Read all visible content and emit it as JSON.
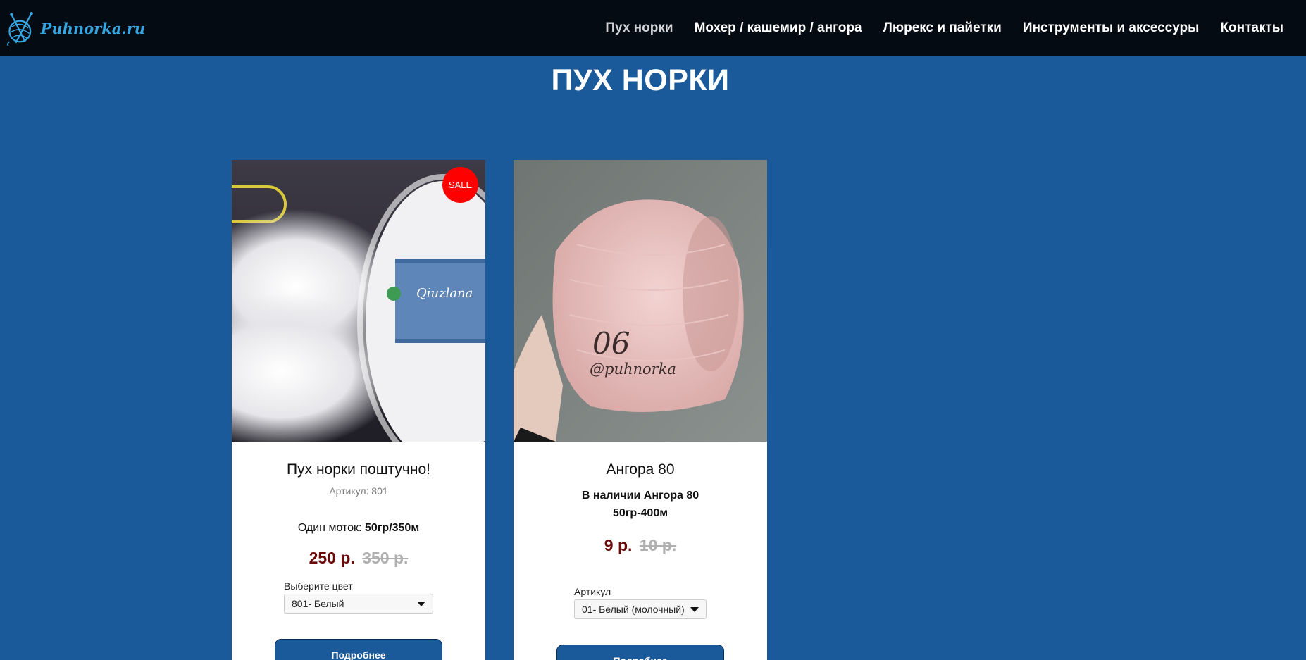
{
  "site": {
    "logo_text": "Puhnorka.ru"
  },
  "nav": {
    "items": [
      {
        "label": "Пух норки",
        "active": true
      },
      {
        "label": "Мохер / кашемир / ангора",
        "active": false
      },
      {
        "label": "Люрекс и пайетки",
        "active": false
      },
      {
        "label": "Инструменты и аксессуры",
        "active": false
      },
      {
        "label": "Контакты",
        "active": false
      }
    ]
  },
  "page": {
    "title": "ПУХ НОРКИ"
  },
  "products": [
    {
      "badge": "SALE",
      "title": "Пух норки поштучно!",
      "sku": "Артикул: 801",
      "desc_label": "Один моток:",
      "desc_value": "50гр/350м",
      "price": "250 р.",
      "old_price": "350 р.",
      "select_label": "Выберите цвет",
      "select_value": "801- Белый",
      "button": "Подробнее"
    },
    {
      "title": "Ангора 80",
      "stock_line1": "В наличии Ангора 80",
      "stock_line2": "50гр-400м",
      "price": "9 р.",
      "old_price": "10 р.",
      "select_label": "Артикул",
      "select_value": "01- Белый (молочный)",
      "button": "Подробнее",
      "image_text_number": "06",
      "image_text_handle": "@puhnorka"
    }
  ],
  "colors": {
    "header_bg": "#050b12",
    "page_bg": "#1b5a9a",
    "price": "#6b0a0a",
    "sale": "#ff0000"
  }
}
